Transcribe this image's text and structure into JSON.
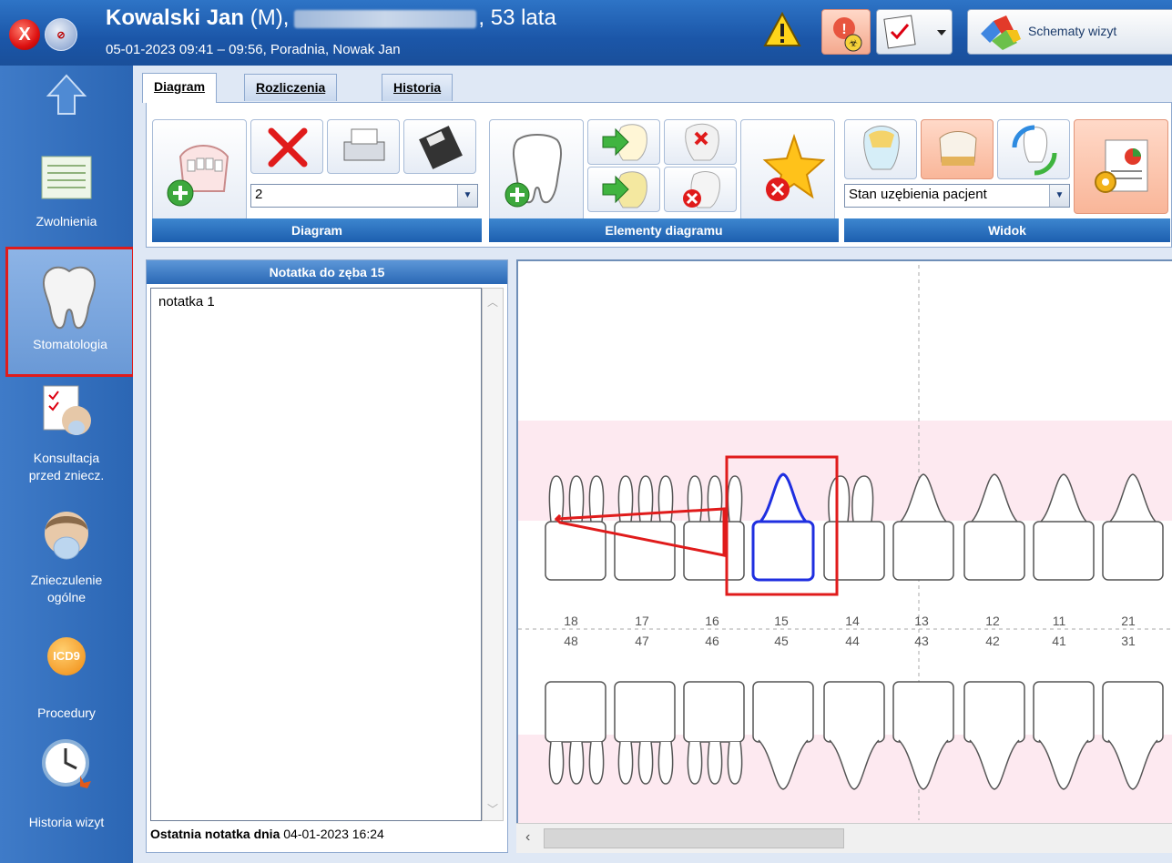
{
  "titlebar": {
    "patient_name": "Kowalski Jan",
    "patient_sex": "(M),",
    "patient_age": ", 53 lata",
    "visit_info": "05-01-2023 09:41 – 09:56, Poradnia, Nowak Jan",
    "close_glyph": "X",
    "schematy_label": "Schematy wizyt"
  },
  "sidebar": {
    "items": [
      {
        "label": "Zwolnienia",
        "icon": "sick-leave-icon"
      },
      {
        "label": "Stomatologia",
        "icon": "tooth-icon"
      },
      {
        "label_line1": "Konsultacja",
        "label_line2": "przed zniecz.",
        "icon": "consultation-icon"
      },
      {
        "label_line1": "Znieczulenie",
        "label_line2": "ogólne",
        "icon": "anesthesia-icon"
      },
      {
        "label": "Procedury",
        "icon": "icd9-icon",
        "badge": "ICD9"
      },
      {
        "label": "Historia wizyt",
        "icon": "history-clock-icon"
      }
    ]
  },
  "tabs": [
    "Diagram",
    "Rozliczenia",
    "Historia"
  ],
  "ribbon": {
    "diagram_group": "Diagram",
    "diagram_combo_value": "2",
    "elements_group": "Elementy diagramu",
    "view_group": "Widok",
    "view_combo_value": "Stan uzębienia pacjent"
  },
  "note": {
    "title": "Notatka do zęba 15",
    "text": "notatka 1",
    "footer_label": "Ostatnia notatka dnia",
    "footer_value": "04-01-2023 16:24"
  },
  "diagram": {
    "upper_numbers": [
      "18",
      "17",
      "16",
      "15",
      "14",
      "13",
      "12",
      "11",
      "21"
    ],
    "lower_numbers": [
      "48",
      "47",
      "46",
      "45",
      "44",
      "43",
      "42",
      "41",
      "31"
    ],
    "selected_tooth": "15",
    "selection_color": "#1f2fe0",
    "highlight_color": "#e01b1b"
  }
}
